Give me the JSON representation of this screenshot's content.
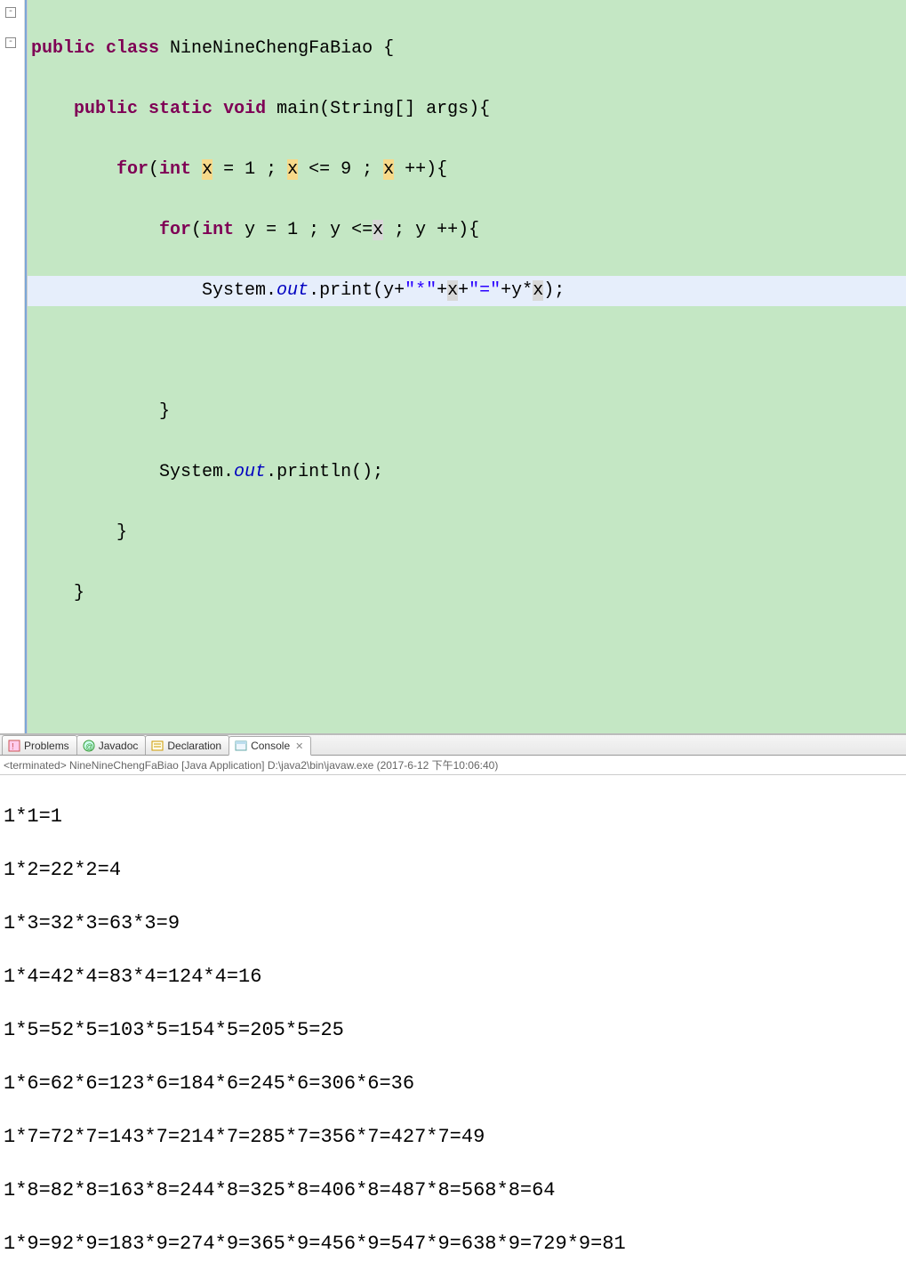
{
  "code": {
    "line1": {
      "kw1": "public",
      "kw2": "class",
      "name": " NineNineChengFaBiao {"
    },
    "line2": {
      "kw1": "public",
      "kw2": "static",
      "kw3": "void",
      "rest": " main(String[] args){"
    },
    "line3": {
      "kw": "for",
      "op": "(",
      "kw2": "int",
      "p1": " ",
      "v1": "x",
      "p2": " = 1 ; ",
      "v2": "x",
      "p3": " <= 9 ; ",
      "v3": "x",
      "p4": " ++){"
    },
    "line4": {
      "kw": "for",
      "op": "(",
      "kw2": "int",
      "p1": " y = 1 ; y <=",
      "v1": "x",
      "p2": " ; y ++){"
    },
    "line5": {
      "p1": "System.",
      "out": "out",
      "p2": ".print(y+",
      "s1": "\"*\"",
      "p3": "+",
      "v1": "x",
      "p4": "+",
      "s2": "\"=\"",
      "p5": "+y*",
      "v2": "x",
      "p6": ");"
    },
    "line6": "",
    "line7": "}",
    "line8": {
      "p1": "System.",
      "out": "out",
      "p2": ".println();"
    },
    "line9": "}",
    "line10": "}",
    "line11": ""
  },
  "tabs": {
    "problems": "Problems",
    "javadoc": "Javadoc",
    "declaration": "Declaration",
    "console": "Console"
  },
  "console": {
    "header": "<terminated> NineNineChengFaBiao [Java Application] D:\\java2\\bin\\javaw.exe (2017-6-12 下午10:06:40)",
    "lines": [
      "1*1=1",
      "1*2=22*2=4",
      "1*3=32*3=63*3=9",
      "1*4=42*4=83*4=124*4=16",
      "1*5=52*5=103*5=154*5=205*5=25",
      "1*6=62*6=123*6=184*6=245*6=306*6=36",
      "1*7=72*7=143*7=214*7=285*7=356*7=427*7=49",
      "1*8=82*8=163*8=244*8=325*8=406*8=487*8=568*8=64",
      "1*9=92*9=183*9=274*9=365*9=456*9=547*9=638*9=729*9=81"
    ]
  }
}
